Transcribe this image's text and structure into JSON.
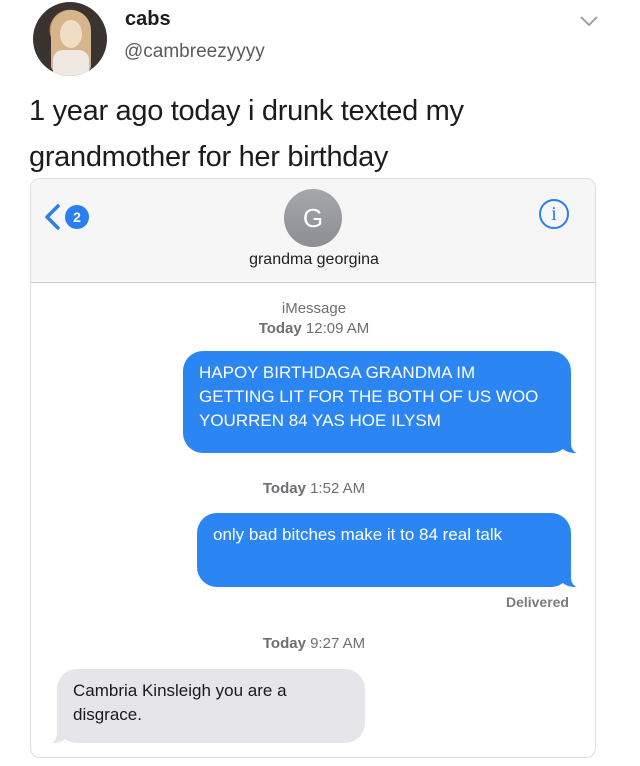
{
  "tweet": {
    "display_name": "cabs",
    "handle": "@cambreezyyyy",
    "text": "1 year ago today i drunk texted my grandmother for her birthday",
    "menu_icon": "chevron-down-icon"
  },
  "imessage": {
    "back_badge": "2",
    "contact_initial": "G",
    "contact_name": "grandma georgina",
    "info_icon": "i",
    "service_label": "iMessage",
    "messages": [
      {
        "stamp_day": "Today",
        "stamp_time": "12:09 AM",
        "direction": "outgoing",
        "text": "HAPOY BIRTHDAGA GRANDMA IM GETTING LIT FOR THE BOTH OF US WOO YOURREN 84 YAS HOE ILYSM"
      },
      {
        "stamp_day": "Today",
        "stamp_time": "1:52 AM",
        "direction": "outgoing",
        "text": "only bad bitches make it to 84 real talk",
        "status": "Delivered"
      },
      {
        "stamp_day": "Today",
        "stamp_time": "9:27 AM",
        "direction": "incoming",
        "text": "Cambria Kinsleigh you are a disgrace."
      }
    ],
    "colors": {
      "outgoing": "#2b86f4",
      "incoming": "#e6e6ea",
      "accent": "#2a7ff0"
    }
  }
}
